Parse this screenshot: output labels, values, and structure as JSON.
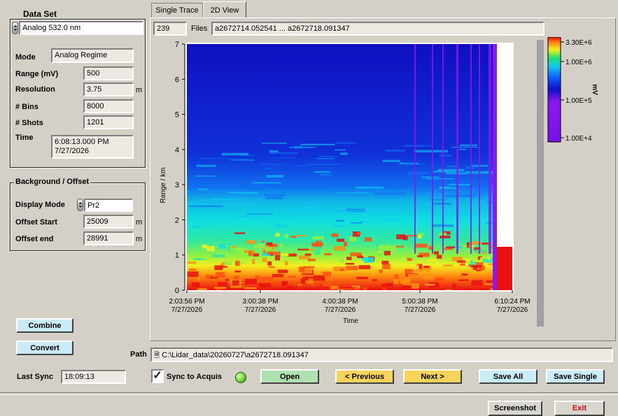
{
  "dataset": {
    "title": "Data Set",
    "selected": "Analog 532.0 nm",
    "mode_label": "Mode",
    "mode_value": "Analog Regime",
    "range_label": "Range (mV)",
    "range_value": "500",
    "resolution_label": "Resolution",
    "resolution_value": "3.75",
    "resolution_unit": "m",
    "bins_label": "# Bins",
    "bins_value": "8000",
    "shots_label": "# Shots",
    "shots_value": "1201",
    "time_label": "Time",
    "time_value_line1": "6:08:13.000 PM",
    "time_value_line2": "7/27/2026"
  },
  "background": {
    "title": "Background / Offset",
    "display_mode_label": "Display Mode",
    "display_mode_value": "Pr2",
    "offset_start_label": "Offset Start",
    "offset_start_value": "25009",
    "offset_start_unit": "m",
    "offset_end_label": "Offset end",
    "offset_end_value": "28991",
    "offset_end_unit": "m"
  },
  "buttons": {
    "combine": "Combine",
    "convert": "Convert",
    "open": "Open",
    "previous": "< Previous",
    "next": "Next  >",
    "save_all": "Save All",
    "save_single": "Save Single",
    "screenshot": "Screenshot",
    "exit": "Exit"
  },
  "tabs": [
    "Single Trace",
    "2D View"
  ],
  "files": {
    "count": "239",
    "label": "Files",
    "range": "a2672714.052541 ... a2672718.091347"
  },
  "path": {
    "label": "Path",
    "value": "C:\\Lidar_data\\20260727\\a2672718.091347"
  },
  "sync": {
    "last_sync_label": "Last Sync",
    "last_sync_value": "18:09:13",
    "sync_label": "Sync to Acquis",
    "checked": true
  },
  "colors": {
    "led": "#66cc33",
    "exit": "#cc1010",
    "accent_next": "#f6d35a"
  },
  "chart_data": {
    "type": "heatmap",
    "xlabel": "Time",
    "ylabel": "Range / km",
    "y_ticks": [
      "0",
      "1",
      "2",
      "3",
      "4",
      "5",
      "6",
      "7"
    ],
    "ylim": [
      0,
      7
    ],
    "x_ticks": [
      {
        "time": "2:03:56 PM",
        "date": "7/27/2026"
      },
      {
        "time": "3:00:38 PM",
        "date": "7/27/2026"
      },
      {
        "time": "4:00:38 PM",
        "date": "7/27/2026"
      },
      {
        "time": "5:00:38 PM",
        "date": "7/27/2026"
      },
      {
        "time": "6:10:24 PM",
        "date": "7/27/2026"
      }
    ],
    "xlim": [
      "2:03:56 PM",
      "6:10:24 PM"
    ],
    "colorbar": {
      "unit": "mV",
      "ticks": [
        "3.30E+6",
        "1.00E+6",
        "1.00E+5",
        "1.00E+4"
      ],
      "scale": "log"
    },
    "layers": [
      {
        "name": "high-signal boundary layer",
        "range_km": [
          0,
          1.2
        ],
        "level": "red/orange"
      },
      {
        "name": "aerosol layer",
        "range_km": [
          1.2,
          2.2
        ],
        "level": "yellow/green"
      },
      {
        "name": "mid layer",
        "range_km": [
          2.2,
          4.2
        ],
        "level": "cyan"
      },
      {
        "name": "upper atmosphere",
        "range_km": [
          4.2,
          7
        ],
        "level": "blue"
      }
    ]
  }
}
